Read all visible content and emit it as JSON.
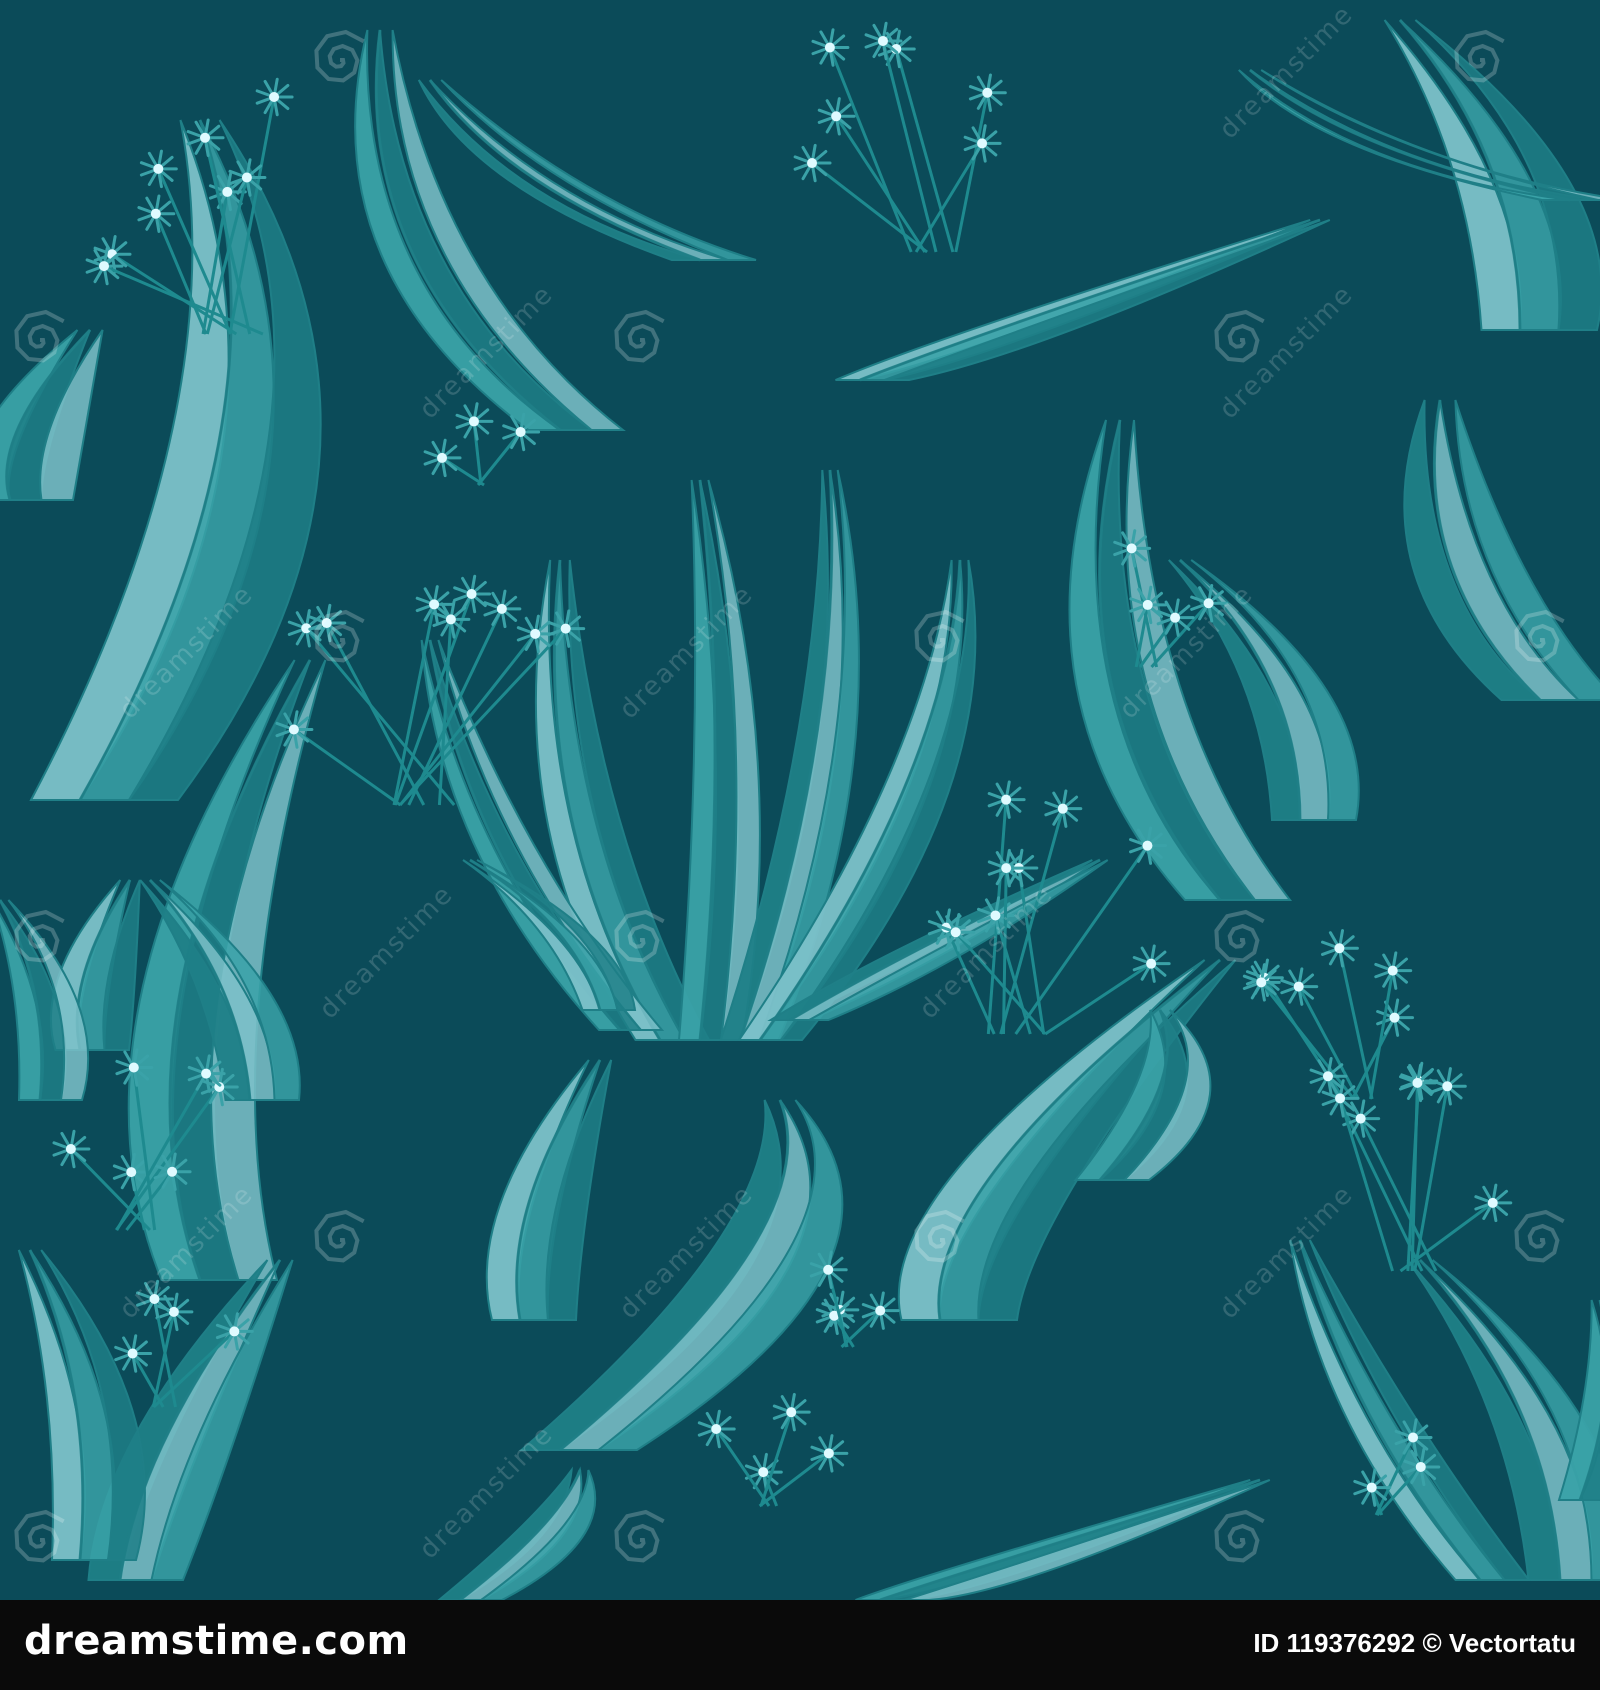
{
  "colors": {
    "background": "#0b4b59",
    "leaf_light": "#7cc1c9",
    "leaf_mid": "#3aa2a8",
    "leaf_dark": "#1f7f87",
    "stem": "#1e8a8f",
    "flower_dot": "#dffaff",
    "footer_bg": "#0a0a0a",
    "footer_text": "#ffffff"
  },
  "watermark": {
    "text": "dreamstime",
    "icon": "spiral-icon"
  },
  "footer": {
    "brand": "dreamstime.com",
    "id_line": "ID 119376292 © Vectortatu"
  }
}
